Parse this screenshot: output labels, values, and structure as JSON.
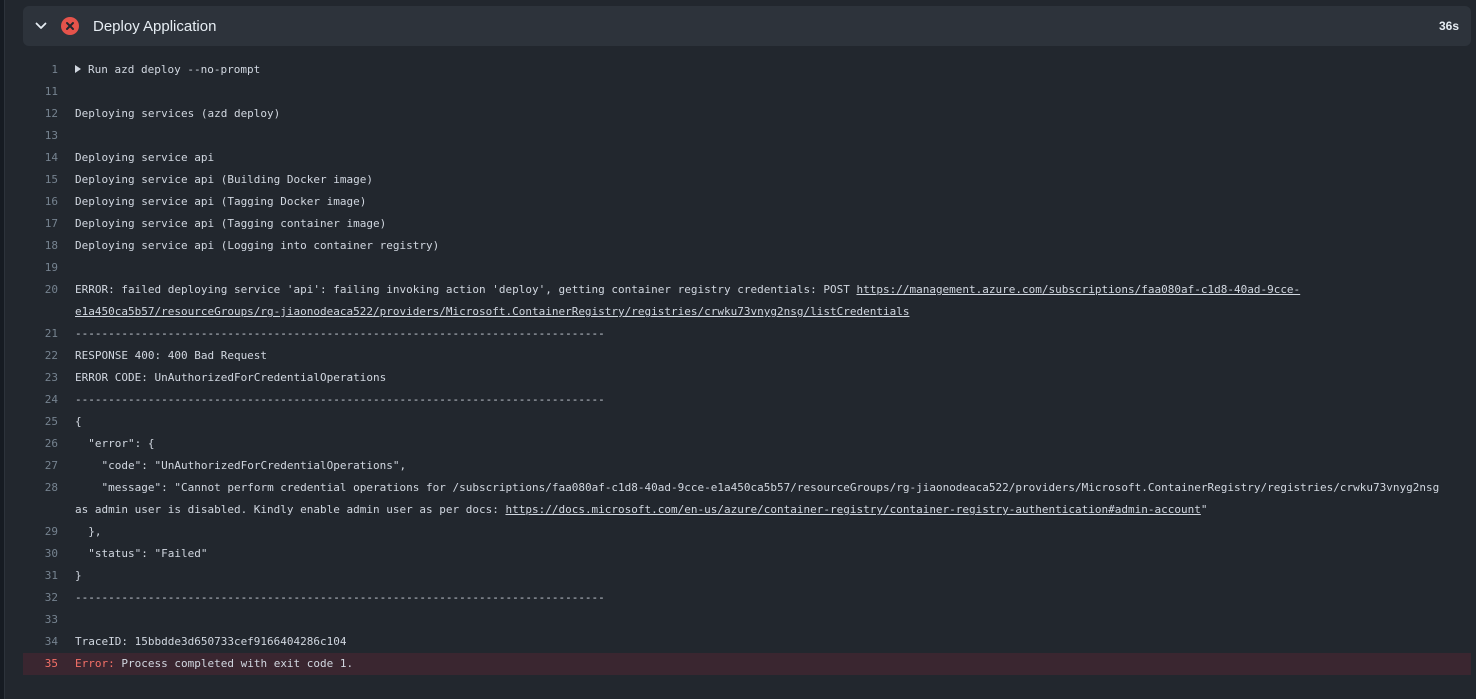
{
  "step": {
    "title": "Deploy Application",
    "duration": "36s",
    "status": "failed",
    "status_color": "#e5534b"
  },
  "log_lines": [
    {
      "num": "1",
      "text": "Run azd deploy --no-prompt",
      "collapsible": true
    },
    {
      "num": "11",
      "text": ""
    },
    {
      "num": "12",
      "text": "Deploying services (azd deploy)"
    },
    {
      "num": "13",
      "text": ""
    },
    {
      "num": "14",
      "text": "Deploying service api"
    },
    {
      "num": "15",
      "text": "Deploying service api (Building Docker image)"
    },
    {
      "num": "16",
      "text": "Deploying service api (Tagging Docker image)"
    },
    {
      "num": "17",
      "text": "Deploying service api (Tagging container image)"
    },
    {
      "num": "18",
      "text": "Deploying service api (Logging into container registry)"
    },
    {
      "num": "19",
      "text": ""
    },
    {
      "num": "20",
      "parts": [
        {
          "text": "ERROR: failed deploying service 'api': failing invoking action 'deploy', getting container registry credentials: POST "
        },
        {
          "text": "https://management.azure.com/subscriptions/faa080af-c1d8-40ad-9cce-e1a450ca5b57/resourceGroups/rg-jiaonodeaca522/providers/Microsoft.ContainerRegistry/registries/crwku73vnyg2nsg/listCredentials",
          "link": true
        }
      ]
    },
    {
      "num": "21",
      "text": "--------------------------------------------------------------------------------"
    },
    {
      "num": "22",
      "text": "RESPONSE 400: 400 Bad Request"
    },
    {
      "num": "23",
      "text": "ERROR CODE: UnAuthorizedForCredentialOperations"
    },
    {
      "num": "24",
      "text": "--------------------------------------------------------------------------------"
    },
    {
      "num": "25",
      "text": "{"
    },
    {
      "num": "26",
      "text": "  \"error\": {"
    },
    {
      "num": "27",
      "text": "    \"code\": \"UnAuthorizedForCredentialOperations\","
    },
    {
      "num": "28",
      "parts": [
        {
          "text": "    \"message\": \"Cannot perform credential operations for /subscriptions/faa080af-c1d8-40ad-9cce-e1a450ca5b57/resourceGroups/rg-jiaonodeaca522/providers/Microsoft.ContainerRegistry/registries/crwku73vnyg2nsg as admin user is disabled. Kindly enable admin user as per docs: "
        },
        {
          "text": "https://docs.microsoft.com/en-us/azure/container-registry/container-registry-authentication#admin-account",
          "link": true
        },
        {
          "text": "\""
        }
      ]
    },
    {
      "num": "29",
      "text": "  },"
    },
    {
      "num": "30",
      "text": "  \"status\": \"Failed\""
    },
    {
      "num": "31",
      "text": "}"
    },
    {
      "num": "32",
      "text": "--------------------------------------------------------------------------------"
    },
    {
      "num": "33",
      "text": ""
    },
    {
      "num": "34",
      "text": "TraceID: 15bbdde3d650733cef9166404286c104"
    },
    {
      "num": "35",
      "error_prefix": "Error:",
      "text": " Process completed with exit code 1.",
      "error": true
    }
  ]
}
